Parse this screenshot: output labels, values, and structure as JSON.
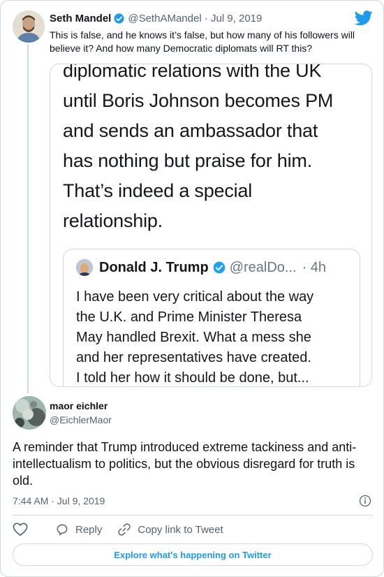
{
  "parent_tweet": {
    "author_name": "Seth Mandel",
    "handle_date": "@SethAMandel · Jul 9, 2019",
    "text": "This is false, and he knows it’s false, but how many of his followers will believe it? And how many Democratic diplomats will RT this?"
  },
  "embedded_screenshot": {
    "text_lines": [
      "diplomatic relations with the UK",
      "until Boris Johnson becomes PM",
      "and sends an ambassador that",
      "has nothing but praise for him.",
      "That’s indeed a special",
      "relationship."
    ],
    "quoted_tweet": {
      "author_name": "Donald J. Trump",
      "handle": "@realDo...",
      "time": "· 4h",
      "text_lines": [
        "I have been very critical about the way",
        "the U.K. and Prime Minister Theresa",
        "May handled Brexit. What a mess she",
        "and her representatives have created.",
        "I told her how it should be done, but..."
      ]
    }
  },
  "main_tweet": {
    "author_name": "maor eichler",
    "handle": "@EichlerMaor",
    "text": "A reminder that Trump introduced extreme tackiness and anti-intellectualism to politics, but the obvious disregard for truth is old.",
    "timestamp": "7:44 AM · Jul 9, 2019"
  },
  "actions": {
    "reply_label": "Reply",
    "copy_link_label": "Copy link to Tweet"
  },
  "explore_label": "Explore what's happening on Twitter",
  "colors": {
    "twitter_blue": "#1d9bf0",
    "secondary_text": "#536471",
    "border": "#cfd9de"
  },
  "icons": [
    "verified-badge-icon",
    "twitter-bird-icon",
    "info-icon",
    "heart-icon",
    "reply-icon",
    "link-icon"
  ]
}
